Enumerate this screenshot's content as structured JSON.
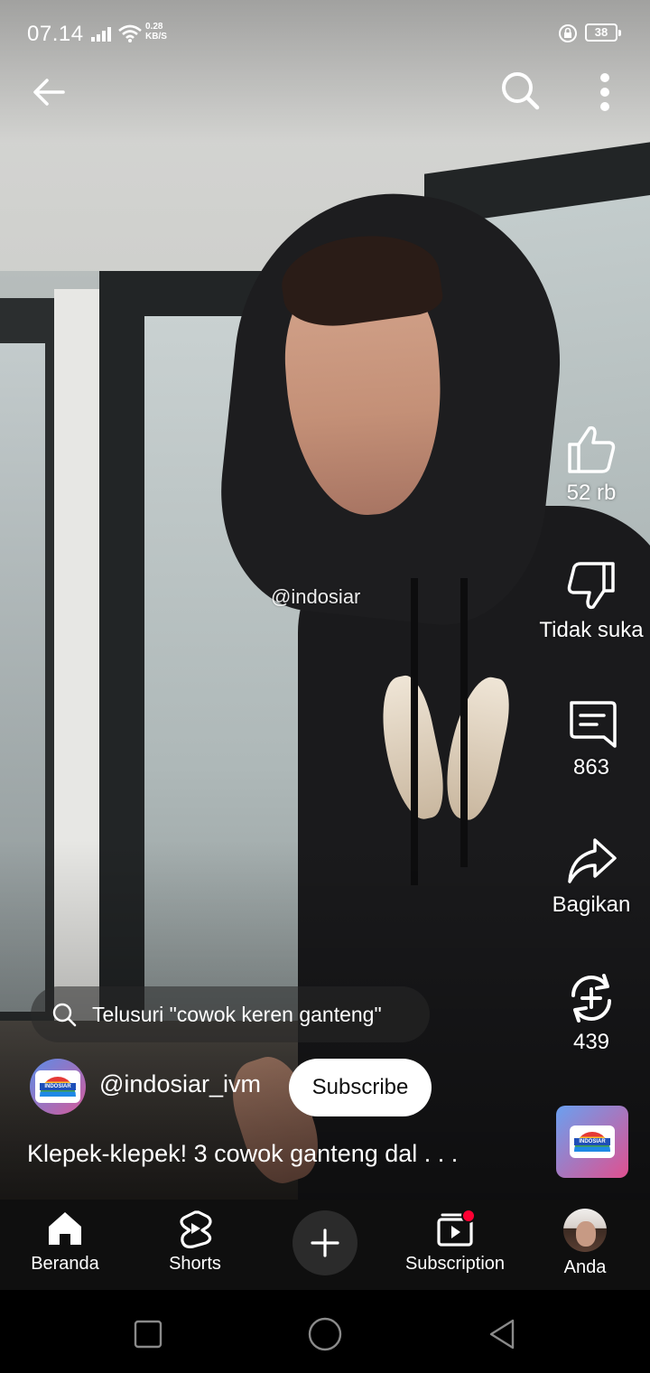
{
  "status_bar": {
    "time": "07.14",
    "net_speed_value": "0.28",
    "net_speed_unit": "KB/S",
    "battery": "38"
  },
  "video": {
    "watermark": "@indosiar"
  },
  "actions": {
    "like_count": "52 rb",
    "dislike_label": "Tidak suka",
    "comment_count": "863",
    "share_label": "Bagikan",
    "remix_count": "439"
  },
  "search_suggestion": {
    "text": "Telusuri \"cowok keren ganteng\""
  },
  "channel": {
    "handle": "@indosiar_ivm",
    "subscribe_label": "Subscribe",
    "logo_text": "INDOSIAR"
  },
  "caption": "Klepek-klepek!  3 cowok ganteng dal . . .",
  "nav": {
    "home": "Beranda",
    "shorts": "Shorts",
    "subscriptions": "Subscription",
    "you": "Anda"
  },
  "icons": {
    "back": "arrow-left-icon",
    "search": "search-icon",
    "more": "more-vert-icon",
    "like": "thumb-up-icon",
    "dislike": "thumb-down-icon",
    "comment": "comment-icon",
    "share": "share-icon",
    "remix": "remix-icon"
  },
  "colors": {
    "accent": "#ff0033",
    "nav_background": "#0f0f0f",
    "subscribe_background": "#ffffff"
  }
}
